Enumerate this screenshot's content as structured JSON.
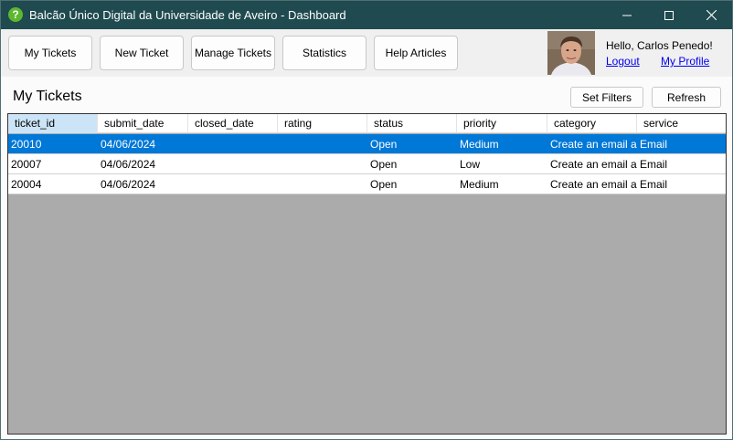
{
  "window": {
    "title": "Balcão Único Digital da Universidade de Aveiro - Dashboard",
    "app_icon_glyph": "?",
    "controls": [
      "minimize-icon",
      "maximize-icon",
      "close-icon"
    ]
  },
  "toolbar": {
    "buttons": [
      {
        "label": "My Tickets"
      },
      {
        "label": "New Ticket"
      },
      {
        "label": "Manage Tickets"
      },
      {
        "label": "Statistics"
      },
      {
        "label": "Help Articles"
      }
    ],
    "user": {
      "greeting": "Hello, Carlos Penedo!",
      "logout_label": "Logout",
      "profile_label": "My Profile"
    }
  },
  "main": {
    "title": "My Tickets",
    "set_filters_label": "Set Filters",
    "refresh_label": "Refresh"
  },
  "table": {
    "columns": [
      "ticket_id",
      "submit_date",
      "closed_date",
      "rating",
      "status",
      "priority",
      "category",
      "service"
    ],
    "rows": [
      {
        "ticket_id": "20010",
        "submit_date": "04/06/2024",
        "closed_date": "",
        "rating": "",
        "status": "Open",
        "priority": "Medium",
        "category": "Create an email a...",
        "service": "Email",
        "selected": true
      },
      {
        "ticket_id": "20007",
        "submit_date": "04/06/2024",
        "closed_date": "",
        "rating": "",
        "status": "Open",
        "priority": "Low",
        "category": "Create an email a...",
        "service": "Email",
        "selected": false
      },
      {
        "ticket_id": "20004",
        "submit_date": "04/06/2024",
        "closed_date": "",
        "rating": "",
        "status": "Open",
        "priority": "Medium",
        "category": "Create an email a...",
        "service": "Email",
        "selected": false
      }
    ]
  },
  "colors": {
    "titlebar": "#1f4a4f",
    "selection": "#0078d7",
    "grid_empty": "#ababab",
    "link": "#0000ee",
    "app_icon": "#5cb82e"
  }
}
